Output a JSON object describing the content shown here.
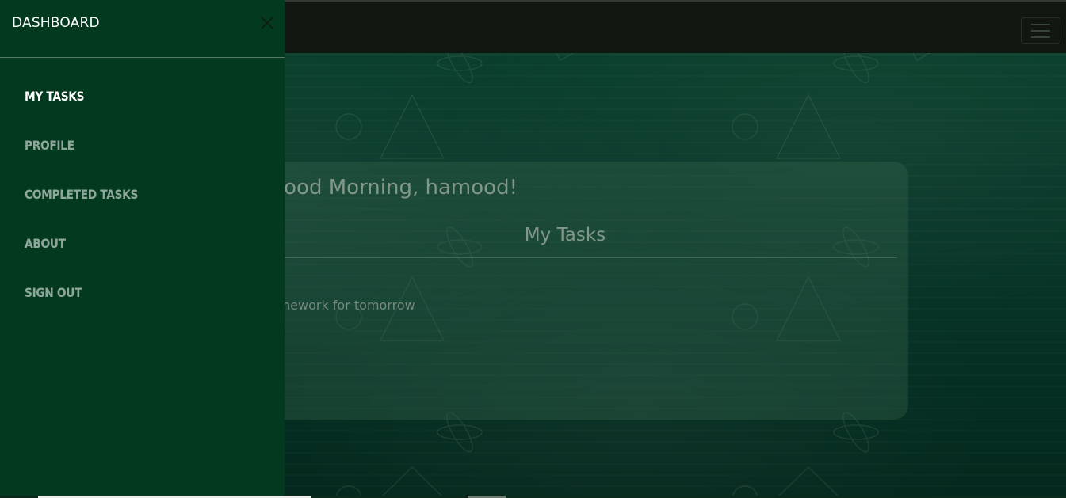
{
  "sidebar": {
    "title": "DASHBOARD",
    "items": [
      {
        "label": "MY TASKS",
        "active": true
      },
      {
        "label": "PROFILE",
        "active": false
      },
      {
        "label": "COMPLETED TASKS",
        "active": false
      },
      {
        "label": "ABOUT",
        "active": false
      },
      {
        "label": "SIGN OUT",
        "active": false
      }
    ]
  },
  "main": {
    "greeting": "Good Morning, hamood!",
    "section_title": "My Tasks",
    "tasks": [
      "Finish homework for tomorrow"
    ]
  },
  "colors": {
    "sidebar_bg": "#033a1f",
    "navbar_bg": "#131a12",
    "active_text": "#ffffff",
    "inactive_text": "#8fa79a"
  },
  "icons": {
    "close": "close-icon",
    "menu": "hamburger-menu-icon"
  }
}
